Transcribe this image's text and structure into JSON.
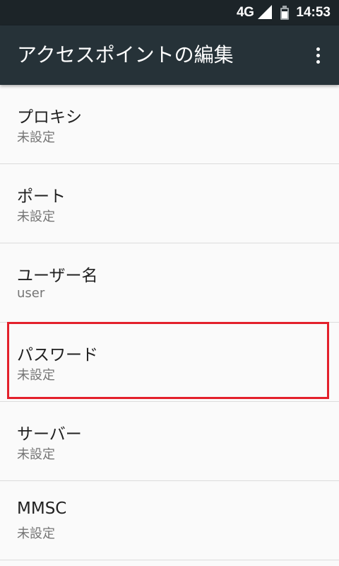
{
  "status_bar": {
    "network": "4G",
    "time": "14:53",
    "icons": [
      "signal-icon",
      "battery-icon"
    ]
  },
  "app_bar": {
    "title": "アクセスポイントの編集",
    "overflow_icon": "more-vert-icon"
  },
  "settings": [
    {
      "title": "プロキシ",
      "summary": "未設定"
    },
    {
      "title": "ポート",
      "summary": "未設定"
    },
    {
      "title": "ユーザー名",
      "summary": "user"
    },
    {
      "title": "パスワード",
      "summary": "未設定"
    },
    {
      "title": "サーバー",
      "summary": "未設定"
    },
    {
      "title": "MMSC",
      "summary": "未設定"
    }
  ],
  "colors": {
    "status_bar": "#1c2428",
    "app_bar": "#263238",
    "background": "#fafafa",
    "highlight": "#e3202b"
  }
}
